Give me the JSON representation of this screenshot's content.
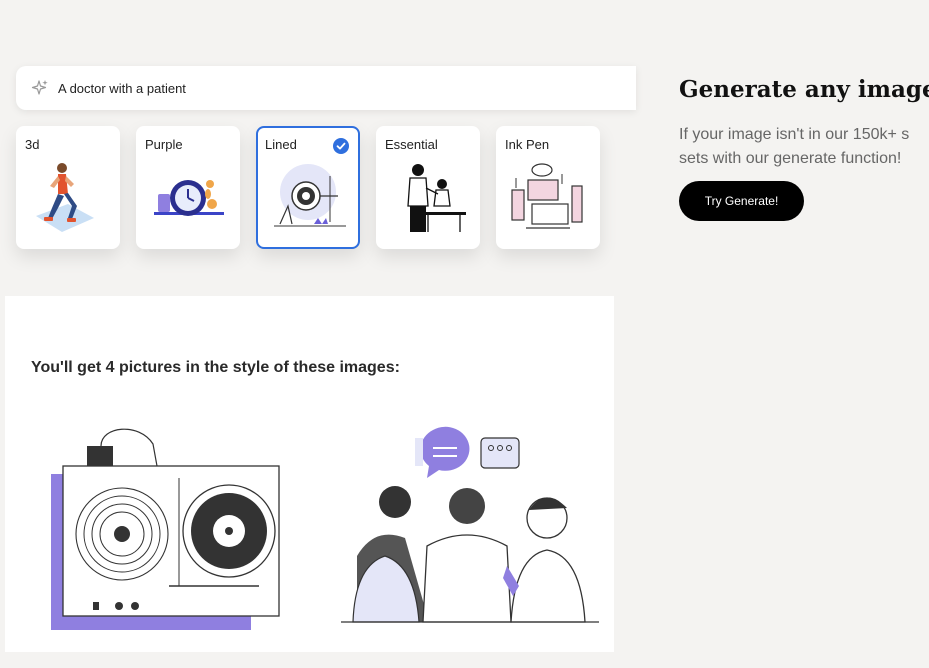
{
  "search": {
    "value": "A doctor with a patient",
    "icon": "sparkle-icon"
  },
  "styles": [
    {
      "label": "3d",
      "selected": false
    },
    {
      "label": "Purple",
      "selected": false
    },
    {
      "label": "Lined",
      "selected": true
    },
    {
      "label": "Essential",
      "selected": false
    },
    {
      "label": "Ink Pen",
      "selected": false
    }
  ],
  "preview": {
    "title": "You'll get 4 pictures in the style of these images:"
  },
  "promo": {
    "heading": "Generate any images y",
    "desc_line1": "If your image isn't in our 150k+ s",
    "desc_line2": "sets with our generate function!",
    "button_label": "Try Generate!"
  },
  "colors": {
    "accent": "#2f6fde",
    "purple": "#8f7fe0",
    "button": "#000000"
  }
}
